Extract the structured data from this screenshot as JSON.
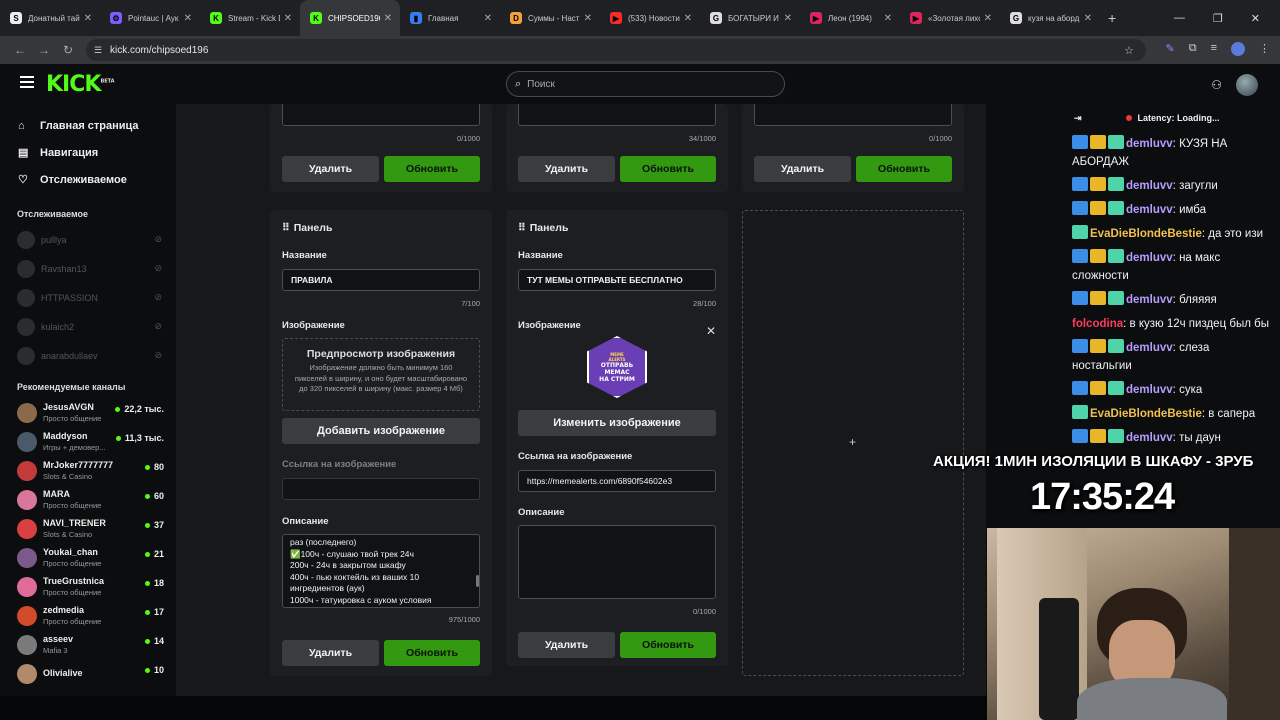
{
  "browser": {
    "tabs": [
      {
        "title": "Донатный тай",
        "color": "#eeeeee",
        "glyph": "S"
      },
      {
        "title": "Pointauc | Аук",
        "color": "#7c5cff",
        "glyph": "⚙"
      },
      {
        "title": "Stream - Kick D",
        "color": "#53fc18",
        "glyph": "K"
      },
      {
        "title": "CHIPSOED196",
        "color": "#53fc18",
        "glyph": "K"
      },
      {
        "title": "Главная",
        "color": "#3b7bf0",
        "glyph": "▮"
      },
      {
        "title": "Суммы - Наст",
        "color": "#f2a33a",
        "glyph": "D"
      },
      {
        "title": "(533) Новости",
        "color": "#ff2a2a",
        "glyph": "▶"
      },
      {
        "title": "БОГАТЫРИ И ,",
        "color": "#dddddd",
        "glyph": "G"
      },
      {
        "title": "Леон (1994)",
        "color": "#e0245e",
        "glyph": "▶"
      },
      {
        "title": "«Золотая лихо",
        "color": "#e0245e",
        "glyph": "▶"
      },
      {
        "title": "кузя на аборд",
        "color": "#dddddd",
        "glyph": "G"
      }
    ],
    "url": "kick.com/chipsoed196"
  },
  "header": {
    "logo": "KICK",
    "logo_badge": "BETA",
    "search_placeholder": "Поиск"
  },
  "sidebar": {
    "nav": [
      {
        "label": "Главная страница",
        "icon": "⌂"
      },
      {
        "label": "Навигация",
        "icon": "▤"
      },
      {
        "label": "Отслеживаемое",
        "icon": "♡"
      }
    ],
    "following_heading": "Отслеживаемое",
    "following": [
      "pulllya",
      "Ravshan13",
      "HTTPASSION",
      "kulaich2",
      "anarabdullaev"
    ],
    "recommended_heading": "Рекомендуемые каналы",
    "recommended": [
      {
        "name": "JesusAVGN",
        "category": "Просто общение",
        "viewers": "22,2 тыс.",
        "color": "#8a6a4a"
      },
      {
        "name": "Maddyson",
        "category": "Игры + демовер...",
        "viewers": "11,3 тыс.",
        "color": "#4b5a6a"
      },
      {
        "name": "MrJoker7777777",
        "category": "Slots & Casino",
        "viewers": "80",
        "color": "#c23a3a"
      },
      {
        "name": "MARA",
        "category": "Просто общение",
        "viewers": "60",
        "color": "#d9779a"
      },
      {
        "name": "NAVI_TRENER",
        "category": "Slots & Casino",
        "viewers": "37",
        "color": "#d94040"
      },
      {
        "name": "Youkai_chan",
        "category": "Просто общение",
        "viewers": "21",
        "color": "#7a5a8a"
      },
      {
        "name": "TrueGrustnica",
        "category": "Просто общение",
        "viewers": "18",
        "color": "#e06a9a"
      },
      {
        "name": "zedmedia",
        "category": "Просто общение",
        "viewers": "17",
        "color": "#d14a2a"
      },
      {
        "name": "asseev",
        "category": "Mafia 3",
        "viewers": "14",
        "color": "#7a7a7a"
      },
      {
        "name": "Olivialive",
        "category": "",
        "viewers": "10",
        "color": "#b08a6a"
      }
    ]
  },
  "panels": {
    "top_counters": [
      "0/1000",
      "34/1000",
      "0/1000"
    ],
    "delete_label": "Удалить",
    "update_label": "Обновить",
    "panel_title": "Панель",
    "name_label": "Название",
    "image_label": "Изображение",
    "image_link_label": "Ссылка на изображение",
    "description_label": "Описание",
    "left": {
      "name_value": "ПРАВИЛА",
      "name_counter": "7/100",
      "preview_title": "Предпросмотр изображения",
      "preview_hint": "Изображение должно быть минимум 160 пикселей в ширину, и оно будет масштабировано до 320 пикселей в ширину (макс. размер 4 Мб)",
      "add_image": "Добавить изображение",
      "image_link_value": "",
      "description_lines": [
        "раз (последнего)",
        "✅100ч - слушаю твой трек 24ч",
        "200ч - 24ч в закрытом шкафу",
        "400ч - пью коктейль из ваших 10",
        "ингредиентов (аук)",
        "1000ч - татуировка с ауком условия"
      ],
      "description_counter": "975/1000"
    },
    "right": {
      "name_value": "ТУТ МЕМЫ ОТПРАВЬТЕ БЕСПЛАТНО",
      "name_counter": "28/100",
      "image_badge_lines": [
        "МЕМЕ",
        "ALERTS",
        "ОТПРАВЬ",
        "МЕМАС",
        "НА СТРИМ"
      ],
      "change_image": "Изменить изображение",
      "image_link_value": "https://memealerts.com/6890f54602e3",
      "description_counter": "0/1000"
    }
  },
  "chat": {
    "latency": "Latency: Loading...",
    "messages": [
      {
        "user": "demluvv",
        "color": "#b79cff",
        "badges": 3,
        "text": "КУЗЯ НА АБОРДАЖ"
      },
      {
        "user": "demluvv",
        "color": "#b79cff",
        "badges": 3,
        "text": "загугли"
      },
      {
        "user": "demluvv",
        "color": "#b79cff",
        "badges": 3,
        "text": "имба"
      },
      {
        "user": "EvaDieBlondeBestie",
        "color": "#f2c14e",
        "badges": 1,
        "text": "да это изи"
      },
      {
        "user": "demluvv",
        "color": "#b79cff",
        "badges": 3,
        "text": "на макс сложности"
      },
      {
        "user": "demluvv",
        "color": "#b79cff",
        "badges": 3,
        "text": "бляяяя"
      },
      {
        "user": "folcodina",
        "color": "#ff3b5c",
        "badges": 0,
        "text": "в кузю 12ч пиздец был бы"
      },
      {
        "user": "demluvv",
        "color": "#b79cff",
        "badges": 3,
        "text": "слеза ностальгии"
      },
      {
        "user": "demluvv",
        "color": "#b79cff",
        "badges": 3,
        "text": "сука"
      },
      {
        "user": "EvaDieBlondeBestie",
        "color": "#f2c14e",
        "badges": 1,
        "text": "в сапера"
      },
      {
        "user": "demluvv",
        "color": "#b79cff",
        "badges": 3,
        "text": "ты даун"
      }
    ]
  },
  "overlay": {
    "promo": "АКЦИЯ! 1МИН ИЗОЛЯЦИИ В ШКАФУ - 3РУБ",
    "clock": "17:35:24"
  }
}
